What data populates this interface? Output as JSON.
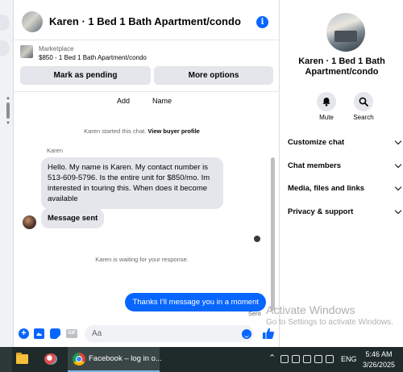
{
  "chat": {
    "header_title": "Karen · 1 Bed 1 Bath Apartment/condo",
    "listing": {
      "label": "Marketplace",
      "title": "$850 - 1 Bed 1 Bath Apartment/condo",
      "mark_pending_label": "Mark as pending",
      "more_options_label": "More options"
    },
    "top_actions": {
      "add_label": "Add",
      "name_label": "Name"
    },
    "started_prefix": "Karen started this chat.",
    "view_buyer_profile": "View buyer profile",
    "sender_name": "Karen",
    "messages": [
      {
        "from": "Karen",
        "text": "Hello. My name is Karen. My contact number is 513-609-5796. Is the entire unit for $850/mo. Im interested in touring this. When does it become available"
      },
      {
        "from": "Karen",
        "text": "Message sent"
      },
      {
        "from": "me",
        "text": "Thanks I'll message you in a moment"
      }
    ],
    "waiting_text": "Karen is waiting for your response.",
    "sent_label": "Sent",
    "composer": {
      "placeholder": "Aa",
      "gif_label": "GIF"
    }
  },
  "info_panel": {
    "name": "Karen · 1 Bed 1 Bath Apartment/condo",
    "mute_label": "Mute",
    "search_label": "Search",
    "sections": [
      "Customize chat",
      "Chat members",
      "Media, files and links",
      "Privacy & support"
    ]
  },
  "watermark": {
    "title": "Activate Windows",
    "subtitle": "Go to Settings to activate Windows."
  },
  "taskbar": {
    "active_app_label": "Facebook – log in o...",
    "language": "ENG",
    "time": "5:46 AM",
    "date": "3/26/2025"
  },
  "colors": {
    "accent": "#0866ff",
    "bubble_gray": "#e4e6eb",
    "taskbar": "#1f2a2a"
  }
}
